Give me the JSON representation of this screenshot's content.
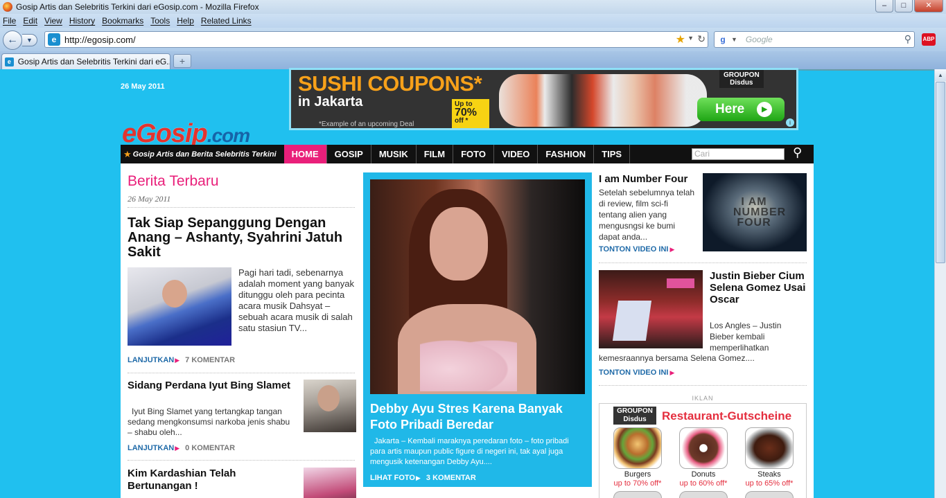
{
  "window": {
    "title": "Gosip Artis dan Selebritis Terkini dari eGosip.com - Mozilla Firefox",
    "minimize": "–",
    "maximize": "□",
    "close": "✕"
  },
  "menu": [
    "File",
    "Edit",
    "View",
    "History",
    "Bookmarks",
    "Tools",
    "Help",
    "Related Links"
  ],
  "toolbar": {
    "url": "http://egosip.com/",
    "search_placeholder": "Google",
    "addon_label": "ABP"
  },
  "tabs": [
    {
      "label": "Gosip Artis dan Selebritis Terkini dari eG..."
    }
  ],
  "page": {
    "date": "26 May 2011",
    "logo": {
      "e": "e",
      "gosip": "Gosip",
      "com": ".com"
    },
    "tagline": "Gosip Artis dan Berita Selebritis Terkini",
    "nav": [
      "HOME",
      "GOSIP",
      "MUSIK",
      "FILM",
      "FOTO",
      "VIDEO",
      "FASHION",
      "TIPS"
    ],
    "nav_active": "HOME",
    "search_placeholder": "Cari"
  },
  "banner_ad": {
    "headline": "SUSHI COUPONS*",
    "subline": "in Jakarta",
    "note": "*Example of an upcoming Deal",
    "percent_prefix": "Up to",
    "percent": "70%",
    "percent_suffix": "off *",
    "brand": "GROUPON",
    "brand_sub": "Disdus",
    "cta": "Here"
  },
  "left": {
    "section_title": "Berita Terbaru",
    "section_date": "26 May 2011",
    "lead": {
      "title": "Tak Siap Sepanggung Dengan Anang – Ashanty, Syahrini Jatuh Sakit",
      "text": "Pagi hari tadi, sebenarnya adalah moment yang banyak ditunggu oleh para pecinta acara musik Dahsyat – sebuah acara musik di salah satu stasiun TV...",
      "more": "LANJUTKAN",
      "comments": "7 KOMENTAR"
    },
    "items": [
      {
        "title": "Sidang Perdana Iyut Bing Slamet",
        "text": "Iyut Bing Slamet yang tertangkap tangan sedang mengkonsumsi narkoba jenis shabu – shabu oleh...",
        "more": "LANJUTKAN",
        "comments": "0 KOMENTAR"
      },
      {
        "title": "Kim Kardashian Telah Bertunangan !"
      }
    ]
  },
  "featured": {
    "title": "Debby Ayu Stres Karena Banyak Foto Pribadi Beredar",
    "text": "Jakarta – Kembali maraknya peredaran foto – foto pribadi para artis maupun public figure di negeri ini, tak ayal juga mengusik ketenangan Debby Ayu....",
    "more": "LIHAT FOTO",
    "comments": "3 KOMENTAR"
  },
  "right": {
    "items": [
      {
        "title": "I am Number Four",
        "text": "Setelah sebelumnya telah di review, film sci-fi tentang alien yang mengusngsi ke bumi dapat anda...",
        "more": "TONTON VIDEO INI",
        "image_text": "I AM NUMBER FOUR"
      },
      {
        "title": "Justin Bieber Cium Selena Gomez Usai Oscar",
        "text_short": "Los Angles – Justin Bieber kembali memperlihatkan",
        "text_long": "kemesraannya bersama Selena Gomez....",
        "more": "TONTON VIDEO INI"
      }
    ],
    "iklan": "IKLAN",
    "ad": {
      "brand": "GROUPON",
      "brand_sub": "Disdus",
      "title": "Restaurant-Gutscheine",
      "foods": [
        {
          "name": "Burgers",
          "price": "up to 70% off*"
        },
        {
          "name": "Donuts",
          "price": "up to 60% off*"
        },
        {
          "name": "Steaks",
          "price": "up to 65% off*"
        }
      ]
    }
  },
  "colors": {
    "page_bg": "#20c0ef",
    "accent_pink": "#e91f7a",
    "link_blue": "#1f6aa8",
    "nav_bg": "#111111"
  }
}
